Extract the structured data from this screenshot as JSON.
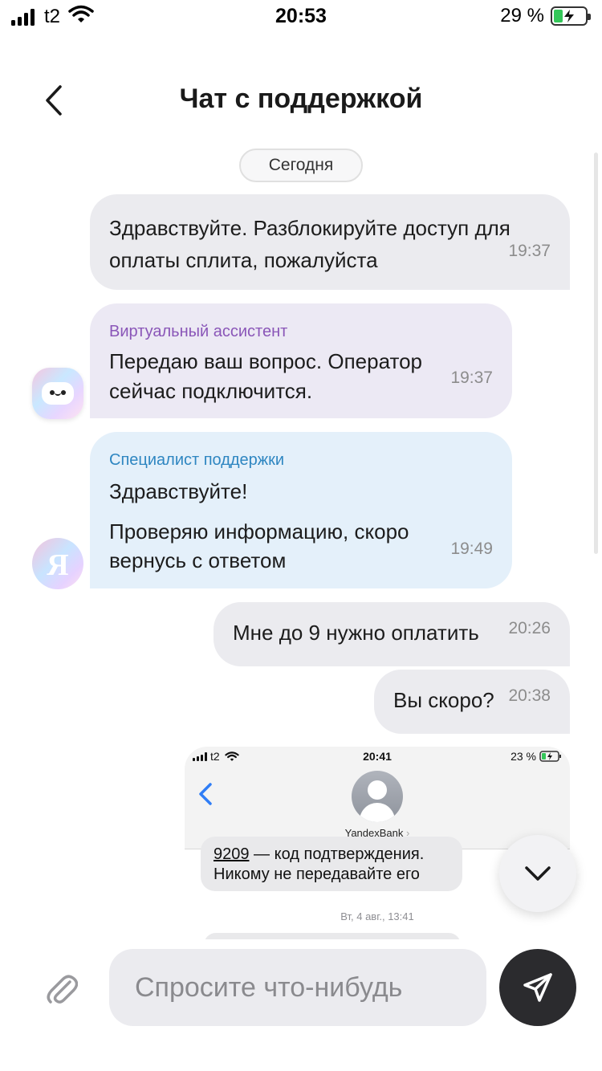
{
  "status_bar": {
    "carrier": "t2",
    "time": "20:53",
    "battery": "29 %",
    "battery_level": 0.29
  },
  "header": {
    "title": "Чат с поддержкой"
  },
  "date_separator": "Сегодня",
  "messages": [
    {
      "text": "Здравствуйте. Разблокируйте доступ для оплаты сплита, пожалуйста",
      "time": "19:37"
    },
    {
      "sender": "Виртуальный ассистент",
      "text": "Передаю ваш вопрос. Оператор сейчас подключится.",
      "time": "19:37"
    },
    {
      "sender": "Специалист поддержки",
      "text_1": "Здравствуйте!",
      "text_2": "Проверяю информацию, скоро вернусь с ответом",
      "time": "19:49"
    },
    {
      "text": "Мне до 9 нужно оплатить",
      "time": "20:26"
    },
    {
      "text": "Вы скоро?",
      "time": "20:38"
    }
  ],
  "attachment": {
    "carrier": "t2",
    "time": "20:41",
    "battery": "23 %",
    "contact": "YandexBank",
    "code": "9209",
    "message_rest": " — код подтверждения.",
    "message_line2": "Никому не передавайте его",
    "date": "Вт, 4 авг., 13:41"
  },
  "composer": {
    "placeholder": "Спросите что-нибудь"
  },
  "colors": {
    "outgoing_bubble": "#ebebef",
    "assistant_bubble": "#ece9f4",
    "support_bubble": "#e4f0fa",
    "assistant_name": "#8a56b8",
    "support_name": "#2e86c1",
    "send_button": "#2b2b2e"
  },
  "icons": [
    "signal-icon",
    "wifi-icon",
    "battery-icon",
    "back-icon",
    "chevron-down-icon",
    "paperclip-icon",
    "send-icon"
  ]
}
